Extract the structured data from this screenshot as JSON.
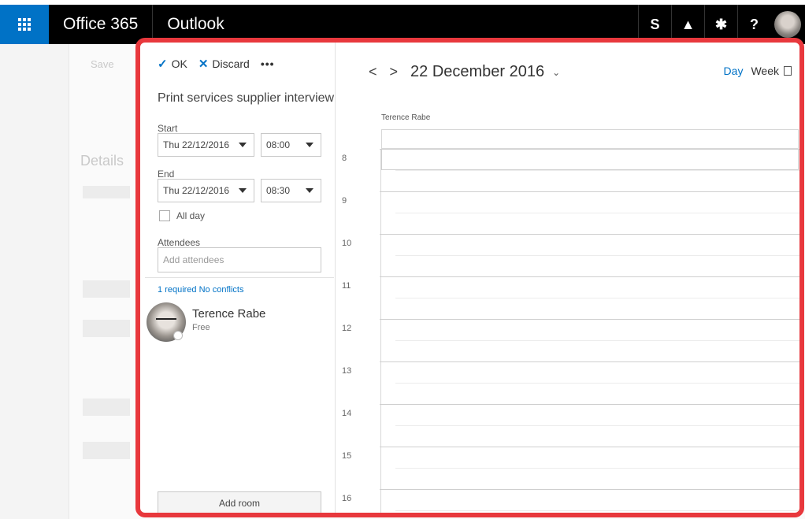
{
  "topbar": {
    "brand": "Office 365",
    "app": "Outlook",
    "icons": [
      {
        "name": "skype-icon",
        "glyph": "S"
      },
      {
        "name": "bell-icon",
        "glyph": "▲"
      },
      {
        "name": "gear-icon",
        "glyph": "✱"
      },
      {
        "name": "help-icon",
        "glyph": "?"
      }
    ],
    "accent": "#0072c6"
  },
  "background": {
    "details_heading": "Details",
    "save_label": "Save"
  },
  "form": {
    "ok_label": "OK",
    "discard_label": "Discard",
    "more_label": "•••",
    "title": "Print services supplier interview",
    "start_label": "Start",
    "start_date": "Thu 22/12/2016",
    "start_time": "08:00",
    "end_label": "End",
    "end_date": "Thu 22/12/2016",
    "end_time": "08:30",
    "all_day_label": "All day",
    "attendees_label": "Attendees",
    "attendees_placeholder": "Add attendees",
    "conflicts_text": "1 required No conflicts",
    "attendee_name": "Terence Rabe",
    "attendee_status": "Free",
    "add_room_label": "Add room"
  },
  "calendar": {
    "prev": "<",
    "next": ">",
    "date": "22 December 2016",
    "date_chevron": "⌄",
    "view_day": "Day",
    "view_week": "Week",
    "column_person": "Terence Rabe",
    "hours": [
      "8",
      "9",
      "10",
      "11",
      "12",
      "13",
      "14",
      "15",
      "16"
    ]
  },
  "highlight_color": "#e8383d"
}
